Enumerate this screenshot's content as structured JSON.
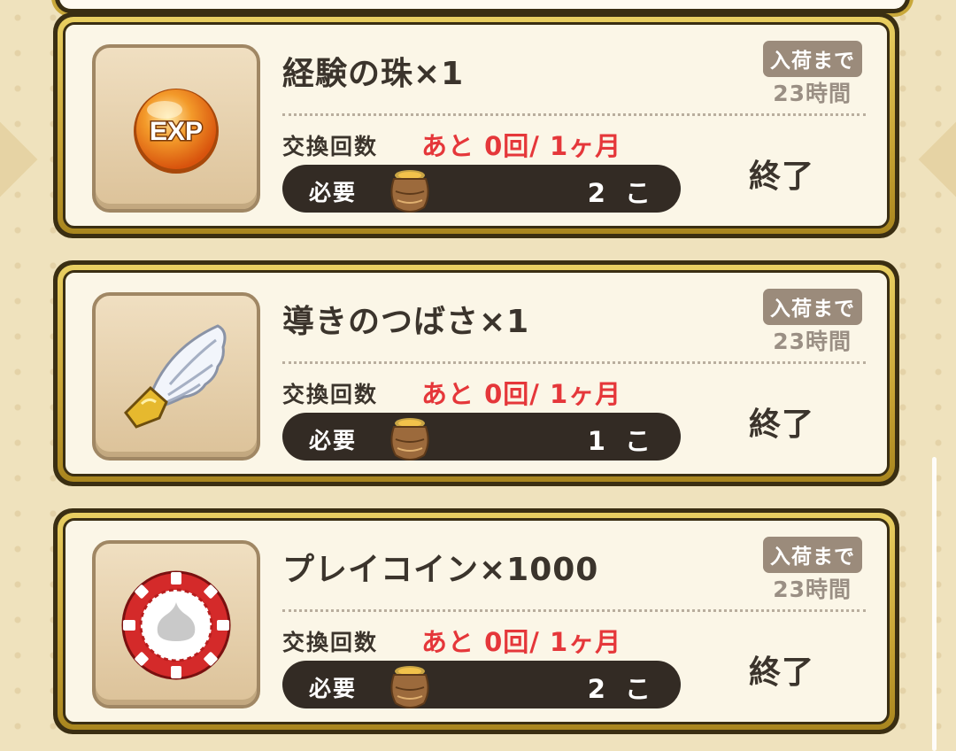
{
  "theme": {
    "accent_red": "#e5373a",
    "text_dark": "#3b342c",
    "badge_bg": "#9b8b7b",
    "pill_bg": "#332b24",
    "frame_gold": "#c7a334"
  },
  "items": [
    {
      "name": "経験の珠×1",
      "icon": "exp-orb-icon",
      "restock_label": "入荷まで",
      "restock_time": "23時間",
      "count_label": "交換回数",
      "count_value": "あと 0回/ 1ヶ月",
      "cost_label": "必要",
      "cost_icon": "pot-icon",
      "cost_amount": "2 こ",
      "status": "終了"
    },
    {
      "name": "導きのつばさ×1",
      "icon": "wing-icon",
      "restock_label": "入荷まで",
      "restock_time": "23時間",
      "count_label": "交換回数",
      "count_value": "あと 0回/ 1ヶ月",
      "cost_label": "必要",
      "cost_icon": "pot-icon",
      "cost_amount": "1 こ",
      "status": "終了"
    },
    {
      "name": "プレイコイン×1000",
      "icon": "play-coin-icon",
      "restock_label": "入荷まで",
      "restock_time": "23時間",
      "count_label": "交換回数",
      "count_value": "あと 0回/ 1ヶ月",
      "cost_label": "必要",
      "cost_icon": "pot-icon",
      "cost_amount": "2 こ",
      "status": "終了"
    }
  ],
  "exp_icon_text": "EXP"
}
